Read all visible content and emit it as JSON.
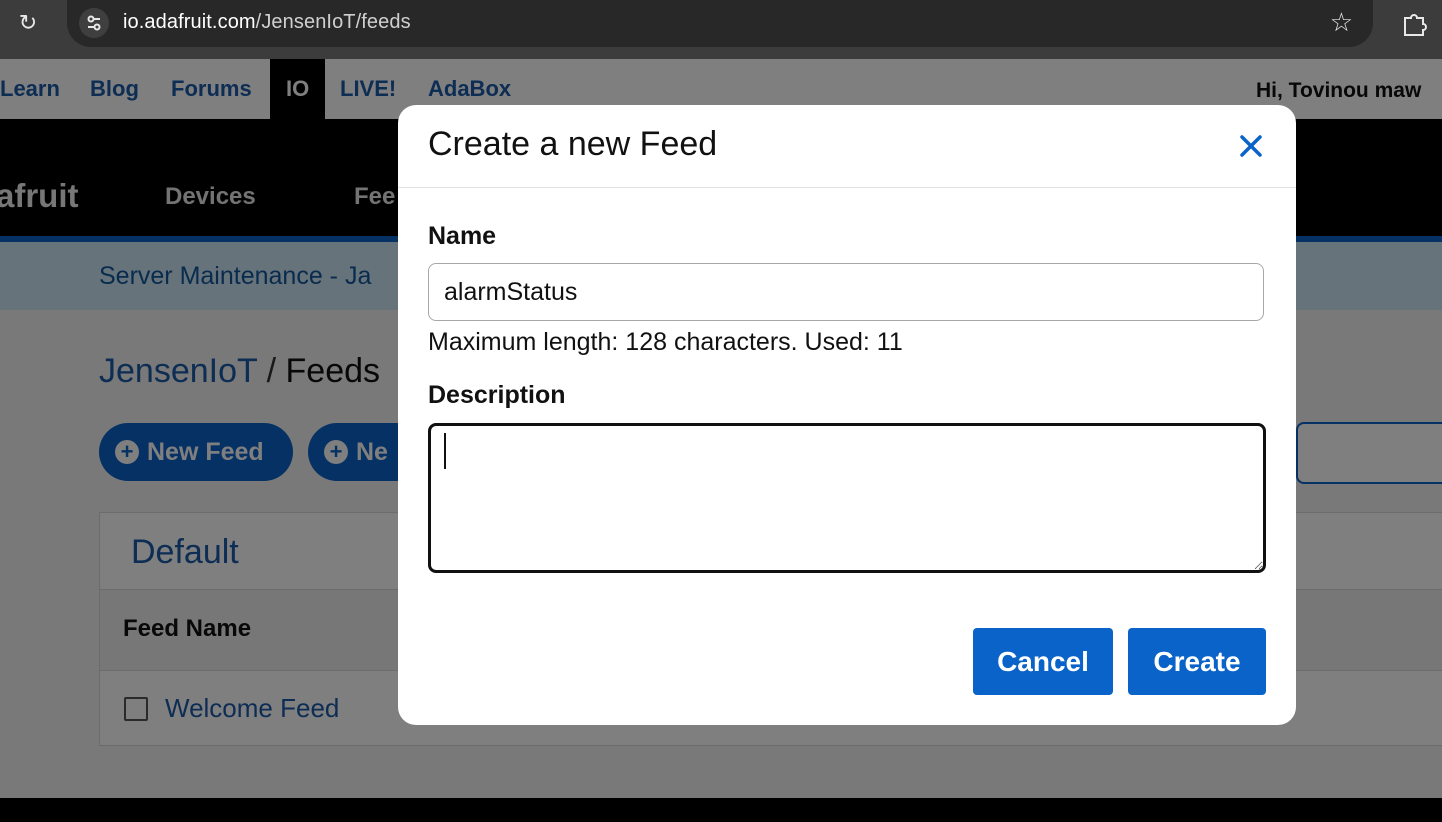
{
  "browser": {
    "url_host": "io.adafruit.com",
    "url_path": "/JensenIoT/feeds"
  },
  "topnav": {
    "items": [
      "Learn",
      "Blog",
      "Forums",
      "IO",
      "LIVE!",
      "AdaBox"
    ],
    "active": "IO",
    "greeting": "Hi, Tovinou maw"
  },
  "mainnav": {
    "brand": "afruit",
    "items": [
      "Devices",
      "Fee"
    ]
  },
  "banner": {
    "text": "Server Maintenance - Ja"
  },
  "breadcrumb": {
    "owner": "JensenIoT",
    "separator": "/",
    "current": "Feeds"
  },
  "actions": {
    "new_feed": "New Feed",
    "new_group": "Ne"
  },
  "group": {
    "title": "Default",
    "column_header": "Feed Name",
    "rows": [
      {
        "name": "Welcome Feed"
      }
    ]
  },
  "modal": {
    "title": "Create a new Feed",
    "name_label": "Name",
    "name_value": "alarmStatus",
    "help_text": "Maximum length: 128 characters. Used: 11",
    "description_label": "Description",
    "description_value": "",
    "cancel_label": "Cancel",
    "create_label": "Create"
  },
  "colors": {
    "accent": "#0a63c8",
    "link": "#1a5aa8",
    "banner_bg": "#cfe6f5"
  }
}
